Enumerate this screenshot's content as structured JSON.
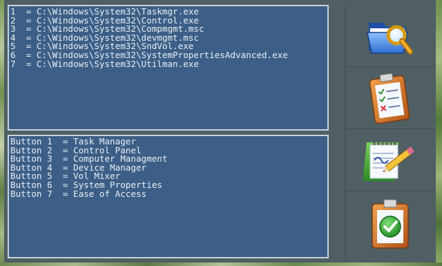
{
  "paths": [
    "1  = C:\\Windows\\System32\\Taskmgr.exe",
    "2  = C:\\Windows\\System32\\Control.exe",
    "3  = C:\\Windows\\System32\\Compmgmt.msc",
    "4  = C:\\Windows\\System32\\devmgmt.msc",
    "5  = C:\\Windows\\System32\\SndVol.exe",
    "6  = C:\\Windows\\System32\\SystemPropertiesAdvanced.exe",
    "7  = C:\\Windows\\System32\\Utilman.exe"
  ],
  "buttons": [
    "Button 1  = Task Manager",
    "Button 2  = Control Panel",
    "Button 3  = Computer Managment",
    "Button 4  = Device Manager",
    "Button 5  = Vol Mixer",
    "Button 6  = System Properties",
    "Button 7  = Ease of Access"
  ],
  "sidebar": {
    "icons": [
      "folder-search-icon",
      "clipboard-checklist-icon",
      "notepad-pencil-icon",
      "clipboard-checkmark-icon"
    ]
  },
  "colors": {
    "pane_bg": "#3d5f87",
    "pane_border": "#c8d3de",
    "text": "#e9eef5",
    "panel_bg": "#4f5f63"
  }
}
